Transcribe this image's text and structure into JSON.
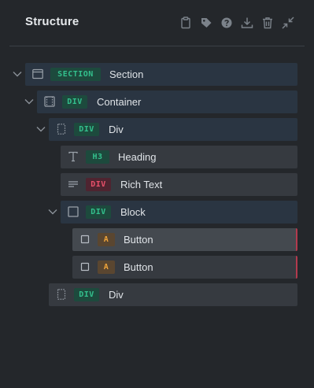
{
  "panel": {
    "title": "Structure",
    "toolbar": [
      {
        "name": "clipboard-icon"
      },
      {
        "name": "tag-icon"
      },
      {
        "name": "help-icon"
      },
      {
        "name": "download-icon"
      },
      {
        "name": "trash-icon"
      },
      {
        "name": "collapse-icon"
      }
    ]
  },
  "tree": [
    {
      "tag": "SECTION",
      "label": "Section"
    },
    {
      "tag": "DIV",
      "label": "Container"
    },
    {
      "tag": "DIV",
      "label": "Div"
    },
    {
      "tag": "H3",
      "label": "Heading"
    },
    {
      "tag": "DIV",
      "label": "Rich Text"
    },
    {
      "tag": "DIV",
      "label": "Block"
    },
    {
      "tag": "A",
      "label": "Button"
    },
    {
      "tag": "A",
      "label": "Button"
    },
    {
      "tag": "DIV",
      "label": "Div"
    }
  ],
  "colors": {
    "background": "#24272b",
    "row_dark": "#2a3542",
    "row_grey": "#363a40",
    "row_selected": "#44494f",
    "badge_green": "#33c08d",
    "badge_red": "#e8506a",
    "badge_orange": "#f0a53a",
    "accent_bar": "#b23a4e"
  }
}
